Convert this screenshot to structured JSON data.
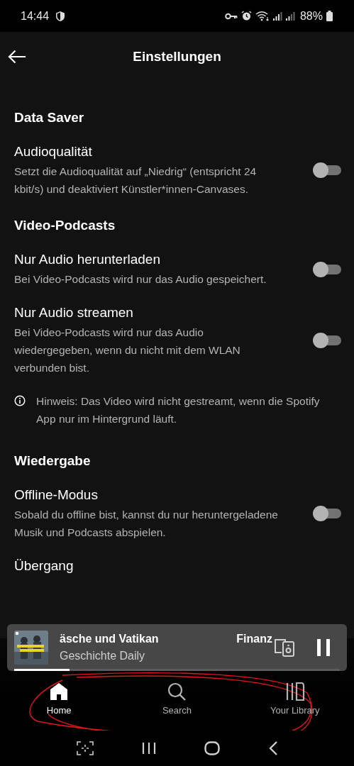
{
  "status_bar": {
    "time": "14:44",
    "battery": "88%"
  },
  "header": {
    "title": "Einstellungen"
  },
  "sections": [
    {
      "heading": "Data Saver",
      "items": [
        {
          "kind": "toggle",
          "title": "Audioqualität",
          "description": "Setzt die Audioqualität auf „Niedrig“ (entspricht 24 kbit/s) und deaktiviert Künstler*innen-Canvases.",
          "on": false
        }
      ]
    },
    {
      "heading": "Video-Podcasts",
      "items": [
        {
          "kind": "toggle",
          "title": "Nur Audio herunterladen",
          "description": "Bei Video-Podcasts wird nur das Audio gespeichert.",
          "on": false
        },
        {
          "kind": "toggle",
          "title": "Nur Audio streamen",
          "description": "Bei Video-Podcasts wird nur das Audio wiedergegeben, wenn du nicht mit dem WLAN verbunden bist.",
          "on": false
        },
        {
          "kind": "note",
          "text": "Hinweis: Das Video wird nicht gestreamt, wenn die Spotify App nur im Hintergrund läuft."
        }
      ]
    },
    {
      "heading": "Wiedergabe",
      "items": [
        {
          "kind": "toggle",
          "title": "Offline-Modus",
          "description": "Sobald du offline bist, kannst du nur heruntergeladene Musik und Podcasts abspielen.",
          "on": false
        },
        {
          "kind": "label",
          "title": "Übergang"
        }
      ]
    }
  ],
  "now_playing": {
    "title": "äsche und Vatikan",
    "title_repeat": "Finanz",
    "artist": "Geschichte Daily",
    "level": 0.17
  },
  "nav_tabs": [
    {
      "label": "Home",
      "selected": true
    },
    {
      "label": "Search",
      "selected": false
    },
    {
      "label": "Your Library",
      "selected": false
    }
  ]
}
